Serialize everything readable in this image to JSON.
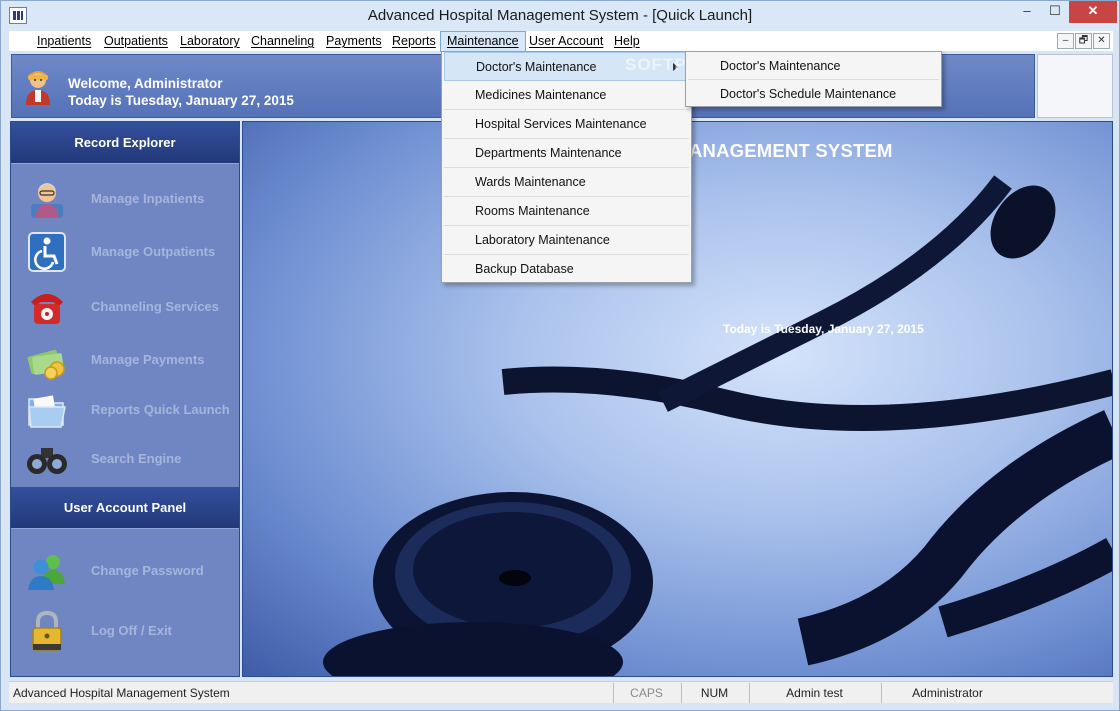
{
  "window": {
    "title": "Advanced Hospital Management System - [Quick Launch]",
    "minimize": "–",
    "maximize": "☐",
    "close": "✕"
  },
  "menubar": {
    "items": [
      "Inpatients",
      "Outpatients",
      "Laboratory",
      "Channeling",
      "Payments",
      "Reports",
      "Maintenance",
      "User Account",
      "Help"
    ],
    "active": "Maintenance",
    "mdi_min": "–",
    "mdi_restore": "🗗",
    "mdi_close": "✕"
  },
  "welcome": {
    "line1": "Welcome, Administrator",
    "line2": "Today is Tuesday, January 27, 2015"
  },
  "sidebar": {
    "record_header": "Record Explorer",
    "record_items": [
      {
        "label": "Manage Inpatients",
        "icon": "patient-icon"
      },
      {
        "label": "Manage Outpatients",
        "icon": "wheelchair-icon"
      },
      {
        "label": "Channeling Services",
        "icon": "telephone-icon"
      },
      {
        "label": "Manage Payments",
        "icon": "money-icon"
      },
      {
        "label": "Reports Quick Launch",
        "icon": "folder-icon"
      },
      {
        "label": "Search Engine",
        "icon": "binoculars-icon"
      }
    ],
    "account_header": "User Account Panel",
    "account_items": [
      {
        "label": "Change Password",
        "icon": "users-icon"
      },
      {
        "label": "Log Off / Exit",
        "icon": "lock-icon"
      }
    ]
  },
  "main": {
    "title": "ANAGEMENT SYSTEM",
    "date": "Today is Tuesday, January 27, 2015"
  },
  "dropdown": {
    "items": [
      "Doctor's Maintenance",
      "Medicines Maintenance",
      "Hospital Services Maintenance",
      "Departments Maintenance",
      "Wards Maintenance",
      "Rooms Maintenance",
      "Laboratory Maintenance",
      "Backup Database"
    ],
    "submenu": [
      "Doctor's Maintenance",
      "Doctor's Schedule Maintenance"
    ],
    "watermark": "SOFTPEDIA"
  },
  "statusbar": {
    "app": "Advanced Hospital Management System",
    "caps": "CAPS",
    "num": "NUM",
    "user": "Admin test",
    "role": "Administrator"
  },
  "colors": {
    "sidebar_bg": "#6f86c3",
    "header_bg": "#22387a",
    "menu_hover": "#d5e6f7"
  }
}
